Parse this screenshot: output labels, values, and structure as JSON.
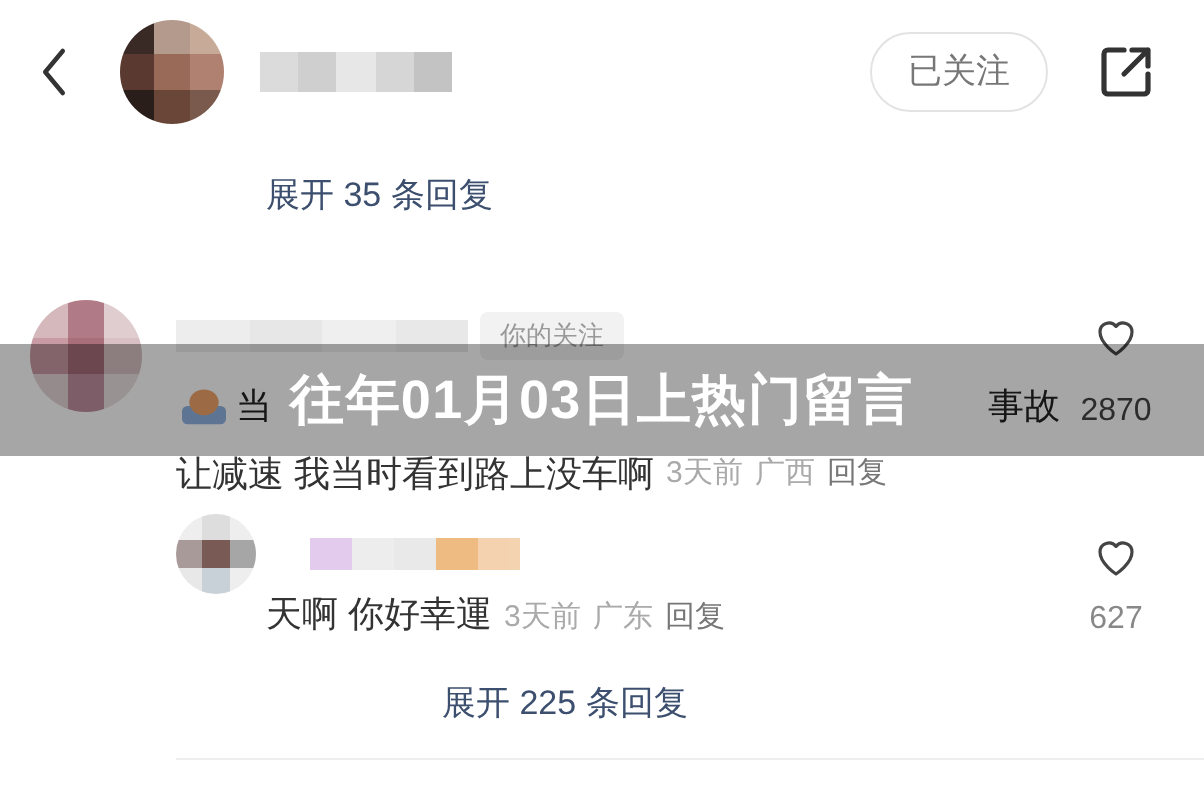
{
  "header": {
    "follow_button": "已关注"
  },
  "replies_link_top": "展开 35 条回复",
  "comments": [
    {
      "badge": "你的关注",
      "first_line": [
        "当",
        "事故"
      ],
      "text": "让减速 我当时看到路上没车啊",
      "meta": [
        "3天前",
        "广西",
        "回复"
      ],
      "likes": "2870"
    },
    {
      "text": "天啊 你好幸運",
      "meta": [
        "3天前",
        "广东",
        "回复"
      ],
      "likes": "627"
    }
  ],
  "replies_link_bottom": "展开 225 条回复",
  "banner": {
    "title": "往年01月03日上热门留言"
  }
}
